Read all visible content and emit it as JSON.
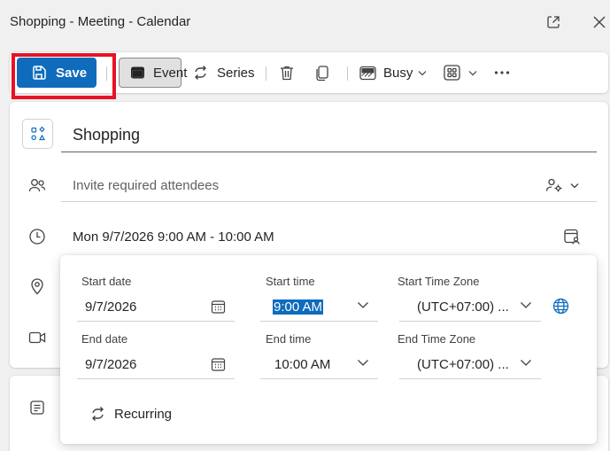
{
  "window": {
    "title": "Shopping - Meeting - Calendar"
  },
  "toolbar": {
    "save_label": "Save",
    "event_label": "Event",
    "series_label": "Series",
    "busy_label": "Busy"
  },
  "form": {
    "title_value": "Shopping",
    "attendees_placeholder": "Invite required attendees",
    "date_summary": "Mon 9/7/2026 9:00 AM - 10:00 AM"
  },
  "datetime_popup": {
    "start_date_label": "Start date",
    "start_date_value": "9/7/2026",
    "start_time_label": "Start time",
    "start_time_value": "9:00 AM",
    "start_tz_label": "Start Time Zone",
    "start_tz_value": "(UTC+07:00) ...",
    "end_date_label": "End date",
    "end_date_value": "9/7/2026",
    "end_time_label": "End time",
    "end_time_value": "10:00 AM",
    "end_tz_label": "End Time Zone",
    "end_tz_value": "(UTC+07:00) ...",
    "recurring_label": "Recurring"
  },
  "colors": {
    "accent": "#0f6cbd",
    "highlight": "#e81224"
  }
}
